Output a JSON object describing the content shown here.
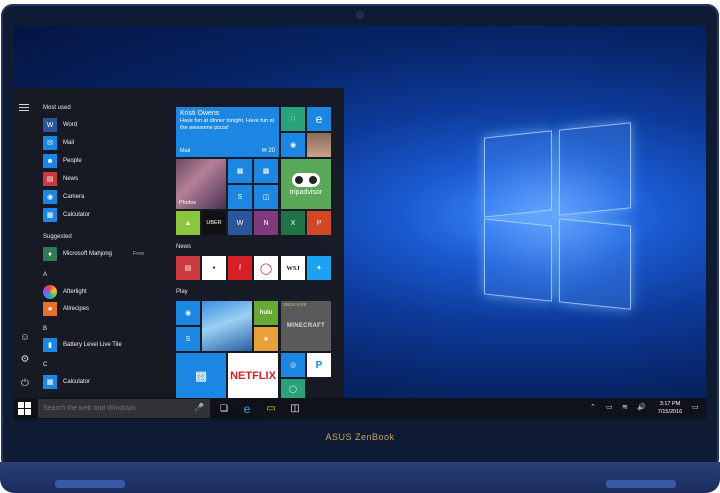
{
  "device": {
    "brand": "ASUS ZenBook"
  },
  "start_menu": {
    "sections": {
      "most_used": "Most used",
      "suggested": "Suggested",
      "letter_a": "A",
      "letter_b": "B",
      "letter_c": "C"
    },
    "most_used": [
      {
        "label": "Word",
        "icon": "word-icon",
        "color": "#2b579a"
      },
      {
        "label": "Mail",
        "icon": "mail-icon",
        "color": "#1c86e3"
      },
      {
        "label": "People",
        "icon": "people-icon",
        "color": "#1c86e3"
      },
      {
        "label": "News",
        "icon": "news-icon",
        "color": "#c9393f"
      },
      {
        "label": "Camera",
        "icon": "camera-icon",
        "color": "#1c86e3"
      },
      {
        "label": "Calculator",
        "icon": "calculator-icon",
        "color": "#1c86e3"
      }
    ],
    "suggested": {
      "label": "Microsoft Mahjong",
      "badge": "Free",
      "icon": "mahjong-icon",
      "color": "#2f7a55"
    },
    "a_apps": [
      {
        "label": "Afterlight",
        "icon": "afterlight-icon",
        "color": "#d86a2a"
      },
      {
        "label": "Allrecipes",
        "icon": "allrecipes-icon",
        "color": "#e8702a"
      }
    ],
    "b_apps": [
      {
        "label": "Battery Level Live Tile",
        "icon": "battery-icon",
        "color": "#1c86e3"
      }
    ],
    "c_apps": [
      {
        "label": "Calculator",
        "icon": "calculator-icon",
        "color": "#1c86e3"
      }
    ],
    "tiles": {
      "mail": {
        "from": "Kristi Owens",
        "message": "Have fun at dinner tonight. Have fun at the awesome pizza!",
        "label": "Mail",
        "count": "20"
      },
      "photos_label": "Photos",
      "tripadvisor_label": "tripadvisor",
      "uber_label": "UBER",
      "news_group": "News",
      "wsj_label": "WSJ",
      "play_group": "Play",
      "hulu_label": "hulu",
      "netflix_label": "NETFLIX",
      "xbox_live_label": "XBOX LIVE",
      "minecraft_label": "MINECRAFT"
    }
  },
  "taskbar": {
    "search_placeholder": "Search the web and Windows",
    "time": "3:17 PM",
    "date": "7/15/2016"
  }
}
